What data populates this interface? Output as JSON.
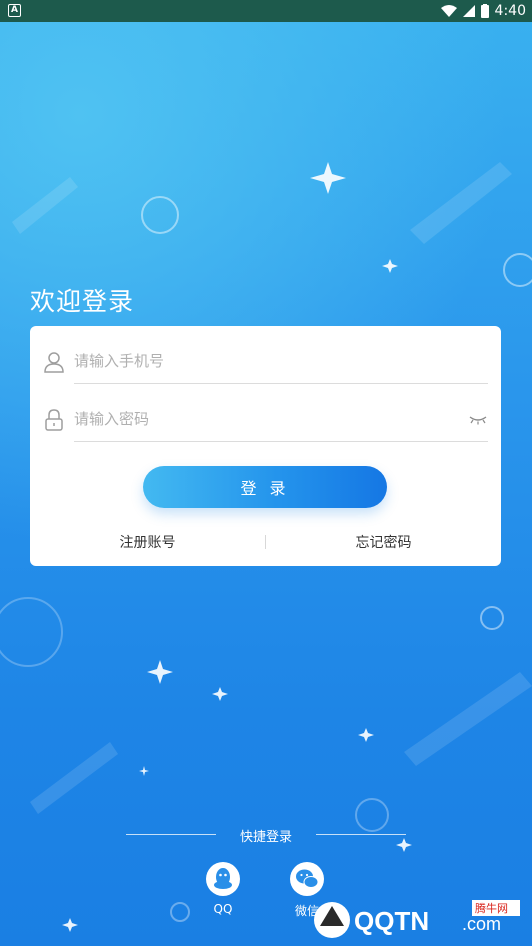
{
  "status_bar": {
    "time": "4:40"
  },
  "login": {
    "welcome": "欢迎登录",
    "phone_placeholder": "请输入手机号",
    "password_placeholder": "请输入密码",
    "login_button": "登 录",
    "register_link": "注册账号",
    "forgot_link": "忘记密码"
  },
  "quick_login": {
    "title": "快捷登录",
    "options": [
      {
        "label": "QQ",
        "icon": "qq-icon"
      },
      {
        "label": "微信",
        "icon": "wechat-icon"
      }
    ]
  },
  "watermark": {
    "brand": "QQTN",
    "suffix": ".com",
    "tag": "腾牛网"
  },
  "colors": {
    "status_bar": "#1d5a4c",
    "gradient_top": "#39b0ef",
    "gradient_bottom": "#1a7fe3",
    "button": "#2494ec"
  }
}
